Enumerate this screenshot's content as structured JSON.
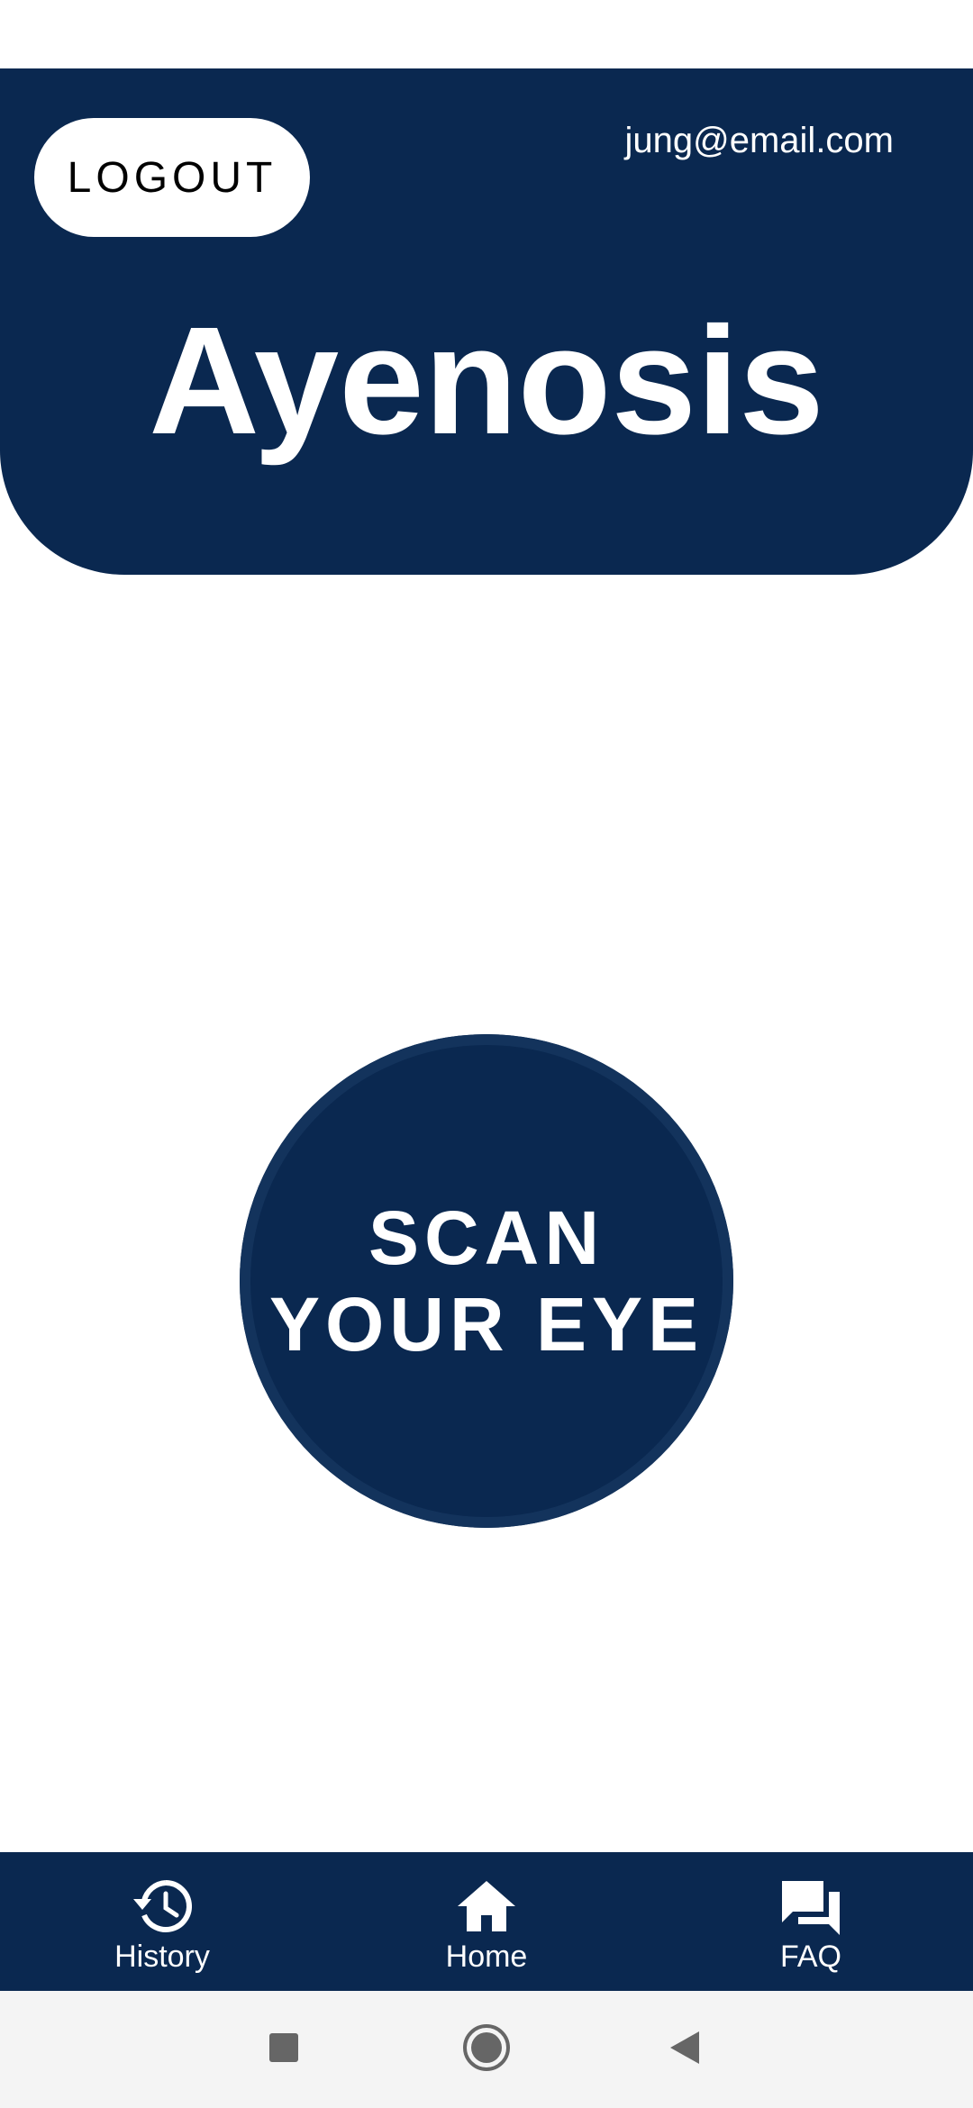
{
  "header": {
    "logout_label": "LOGOUT",
    "user_email": "jung@email.com",
    "app_title": "Ayenosis"
  },
  "scan_button": {
    "line1": "SCAN",
    "line2": "YOUR EYE"
  },
  "bottom_nav": {
    "items": [
      {
        "label": "History",
        "icon": "history-icon"
      },
      {
        "label": "Home",
        "icon": "home-icon"
      },
      {
        "label": "FAQ",
        "icon": "faq-icon"
      }
    ]
  },
  "system_nav": {
    "buttons": [
      "recent-apps-icon",
      "home-circle-icon",
      "back-icon"
    ]
  },
  "colors": {
    "primary": "#0a2850",
    "on_primary": "#ffffff",
    "background": "#ffffff"
  }
}
